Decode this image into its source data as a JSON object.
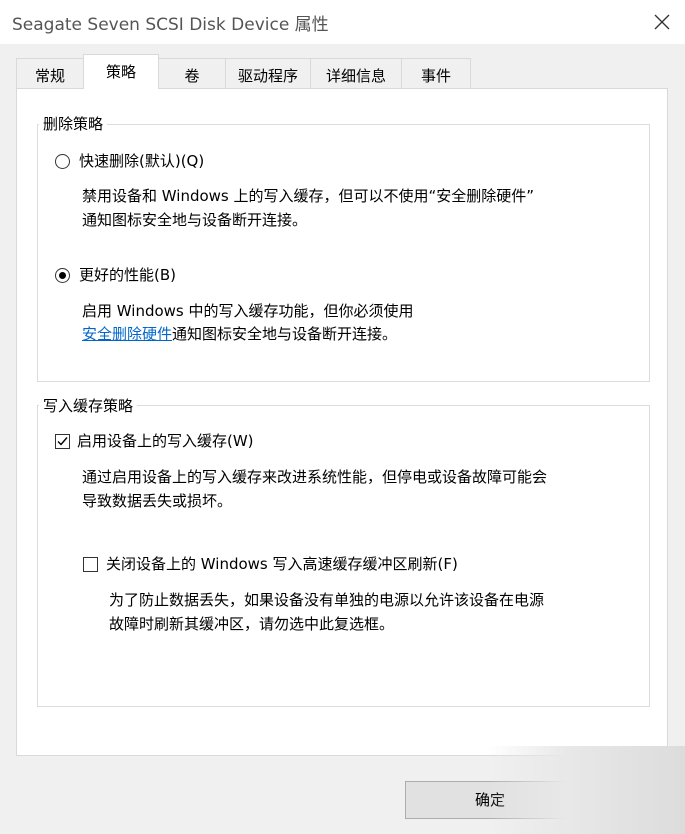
{
  "window": {
    "title": "Seagate Seven SCSI Disk Device 属性"
  },
  "tabs": [
    {
      "label": "常规"
    },
    {
      "label": "策略"
    },
    {
      "label": "卷"
    },
    {
      "label": "驱动程序"
    },
    {
      "label": "详细信息"
    },
    {
      "label": "事件"
    }
  ],
  "removal": {
    "title": "删除策略",
    "quick": {
      "label": "快速删除(默认)(Q)",
      "desc1": "禁用设备和 Windows 上的写入缓存，但可以不使用“安全删除硬件”",
      "desc2": "通知图标安全地与设备断开连接。",
      "selected": false
    },
    "better": {
      "label": "更好的性能(B)",
      "desc1": "启用 Windows 中的写入缓存功能，但你必须使用",
      "link": "安全删除硬件",
      "desc2": "通知图标安全地与设备断开连接。",
      "selected": true
    }
  },
  "cache": {
    "title": "写入缓存策略",
    "enable": {
      "label": "启用设备上的写入缓存(W)",
      "desc1": "通过启用设备上的写入缓存来改进系统性能，但停电或设备故障可能会",
      "desc2": "导致数据丢失或损坏。",
      "checked": true
    },
    "flush": {
      "label": "关闭设备上的 Windows 写入高速缓存缓冲区刷新(F)",
      "desc1": "为了防止数据丢失，如果设备没有单独的电源以允许该设备在电源",
      "desc2": "故障时刷新其缓冲区，请勿选中此复选框。",
      "checked": false
    }
  },
  "footer": {
    "ok_label": "确定"
  }
}
